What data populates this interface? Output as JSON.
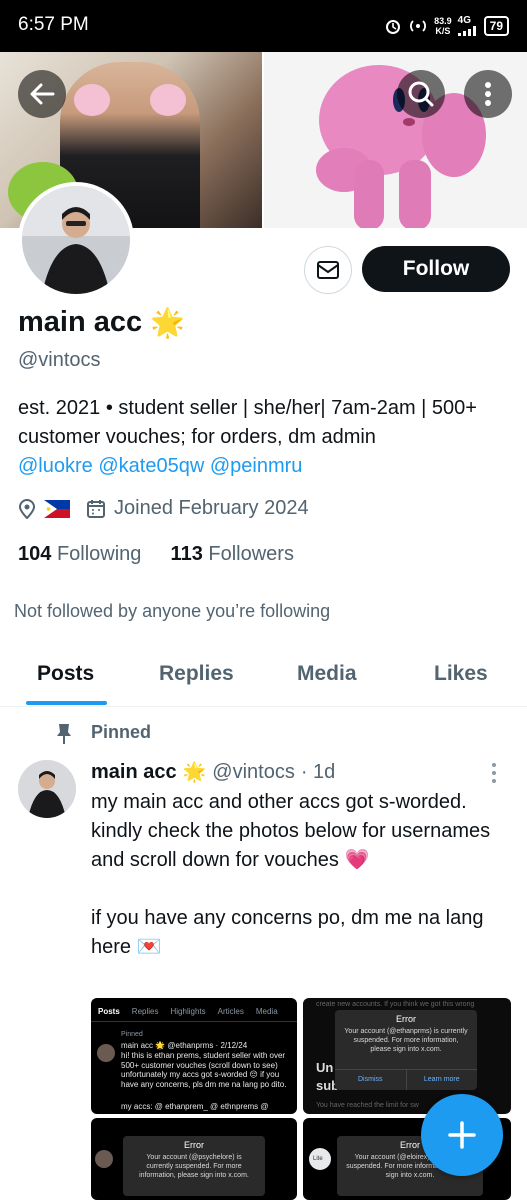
{
  "status_bar": {
    "time": "6:57 PM",
    "speed_value": "83.9",
    "speed_unit": "K/S",
    "network": "4G",
    "battery": "79"
  },
  "profile": {
    "name": "main acc",
    "handle": "@vintocs",
    "bio_text": "est. 2021 • student seller | she/her| 7am-2am | 500+ customer vouches; for orders, dm admin",
    "bio_links": [
      "@luokre",
      "@kate05qw",
      "@peinmru"
    ],
    "joined": "Joined February 2024",
    "following_count": "104",
    "following_label": "Following",
    "followers_count": "113",
    "followers_label": "Followers",
    "not_followed_text": "Not followed by anyone you’re following",
    "follow_button": "Follow"
  },
  "tabs": [
    "Posts",
    "Replies",
    "Media",
    "Likes"
  ],
  "post": {
    "pinned_label": "Pinned",
    "author": "main acc",
    "handle": "@vintocs",
    "time": "· 1d",
    "text_p1": "my main acc and other accs got s-worded. kindly check the photos below for usernames and scroll down for vouches 💗",
    "text_p2": "if you have any concerns po, dm me na lang here 💌"
  },
  "media": {
    "c1": {
      "tabs": [
        "Posts",
        "Replies",
        "Highlights",
        "Articles",
        "Media"
      ],
      "pinned": "Pinned",
      "head": "main acc 🌟 @ethanprms · 2/12/24",
      "body": "hi! this is ethan prems, student seller with over 500+ customer vouches (scroll down to see) unfortunately my accs got s-worded 😔 if you have any concerns, pls dm me na lang po dito.",
      "foot": "my accs: @ ethanprem_  @ ethnprems @"
    },
    "c2": {
      "top": "create new accounts. If you think we got this wrong",
      "side1": "Un",
      "side2": "sub",
      "bottom": "You have reached the limit for sw",
      "error_title": "Error",
      "error_body": "Your account (@ethanprms) is currently suspended. For more information, please sign into x.com.",
      "dismiss": "Dismiss",
      "learn": "Learn more"
    },
    "c3": {
      "error_title": "Error",
      "error_body": "Your account (@psychelore) is currently suspended. For more information, please sign into x.com."
    },
    "c4": {
      "error_title": "Error",
      "error_body": "Your account (@eloirex) is currently suspended. For more information, please sign into x.com.",
      "label": "Lite"
    }
  },
  "icons": {
    "back": "back-arrow-icon",
    "search": "search-icon",
    "more": "more-vertical-icon",
    "message": "envelope-icon",
    "location": "location-pin-icon",
    "flag": "philippines-flag-icon",
    "calendar": "calendar-icon",
    "pin": "pin-icon",
    "compose": "plus-icon",
    "star": "star-emoji-icon"
  },
  "colors": {
    "accent": "#1d9bf0",
    "text": "#0f1419",
    "secondary": "#536471",
    "follow_bg": "#0f1419"
  }
}
